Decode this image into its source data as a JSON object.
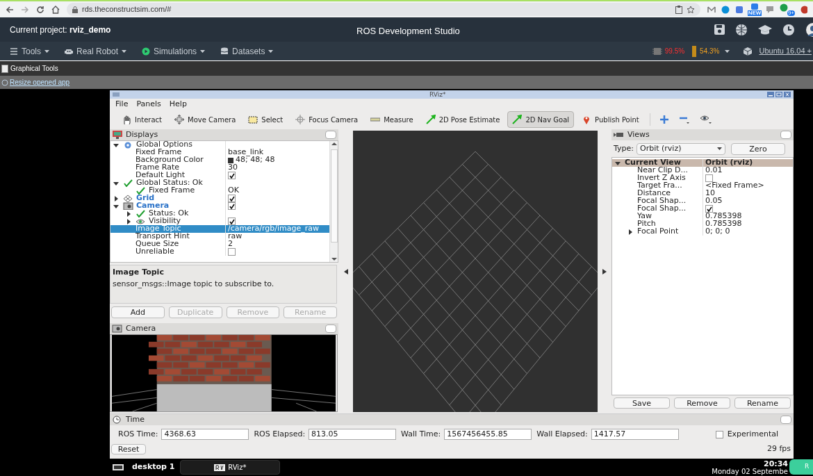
{
  "browser": {
    "url": "rds.theconstructsim.com/#",
    "extension_badges": [
      "NEW",
      "9+"
    ]
  },
  "rds": {
    "project": "Current project: **rviz_demo**",
    "title": "ROS Development Studio",
    "menu": [
      {
        "label": "Tools"
      },
      {
        "label": "Real Robot"
      },
      {
        "label": "Simulations"
      },
      {
        "label": "Datasets"
      }
    ],
    "cpu": "99.5%",
    "memory": "54.3%",
    "os": "Ubuntu 16.04 +"
  },
  "graphical_tools": "Graphical Tools",
  "resize_link": "Resize opened app",
  "rviz": {
    "title": "RViz*",
    "menu": [
      "File",
      "Panels",
      "Help"
    ],
    "toolbar": [
      {
        "label": "Interact",
        "selected": false
      },
      {
        "label": "Move Camera",
        "selected": false
      },
      {
        "label": "Select",
        "selected": false
      },
      {
        "label": "Focus Camera",
        "selected": false
      },
      {
        "label": "Measure",
        "selected": false
      },
      {
        "label": "2D Pose Estimate",
        "selected": false
      },
      {
        "label": "2D Nav Goal",
        "selected": true
      },
      {
        "label": "Publish Point",
        "selected": false
      }
    ],
    "displays": {
      "title": "Displays",
      "tree": [
        {
          "kind": "global-options",
          "label": "Global Options",
          "expanded": true,
          "selected": false,
          "children": [
            {
              "kind": "property",
              "label": "Fixed Frame",
              "value": "base_link",
              "selected": false
            },
            {
              "kind": "property",
              "label": "Background Color",
              "value": "48; 48; 48",
              "color": "#303030",
              "selected": false
            },
            {
              "kind": "property",
              "label": "Frame Rate",
              "value": "30",
              "selected": false
            },
            {
              "kind": "property",
              "label": "Default Light",
              "checked": true,
              "selected": false
            }
          ]
        },
        {
          "kind": "status",
          "label": "Global Status: Ok",
          "expanded": true,
          "selected": false,
          "children": [
            {
              "kind": "status",
              "label": "Fixed Frame",
              "value": "OK",
              "selected": false
            }
          ]
        },
        {
          "kind": "grid-display",
          "label": "Grid",
          "expanded": false,
          "checked": true,
          "selected": false
        },
        {
          "kind": "camera-display",
          "label": "Camera",
          "expanded": true,
          "checked": true,
          "selected": false,
          "children": [
            {
              "kind": "status",
              "label": "Status: Ok",
              "expanded": false,
              "selected": false
            },
            {
              "kind": "visibility",
              "label": "Visibility",
              "expanded": false,
              "checked": true,
              "selected": false
            },
            {
              "kind": "property",
              "label": "Image Topic",
              "value": "/camera/rgb/image_raw",
              "selected": true
            },
            {
              "kind": "property",
              "label": "Transport Hint",
              "value": "raw",
              "selected": false
            },
            {
              "kind": "property",
              "label": "Queue Size",
              "value": "2",
              "selected": false
            },
            {
              "kind": "property",
              "label": "Unreliable",
              "checked": false,
              "selected": false
            }
          ]
        }
      ],
      "description_title": "Image Topic",
      "description": "sensor_msgs::Image topic to subscribe to.",
      "buttons": [
        {
          "label": "Add",
          "disabled": false
        },
        {
          "label": "Duplicate",
          "disabled": true
        },
        {
          "label": "Remove",
          "disabled": true
        },
        {
          "label": "Rename",
          "disabled": true
        }
      ]
    },
    "camera": {
      "title": "Camera"
    },
    "views": {
      "title": "Views",
      "type_label": "Type:",
      "type_value": "Orbit (rviz)",
      "zero": "Zero",
      "tree": [
        {
          "kind": "header",
          "label": "Current View",
          "value": "Orbit (rviz)",
          "expanded": true,
          "children": [
            {
              "label": "Near Clip D...",
              "value": "0.01"
            },
            {
              "label": "Invert Z Axis",
              "checked": false
            },
            {
              "label": "Target Fra...",
              "value": "<Fixed Frame>"
            },
            {
              "label": "Distance",
              "value": "10"
            },
            {
              "label": "Focal Shap...",
              "value": "0.05"
            },
            {
              "label": "Focal Shap...",
              "checked": true
            },
            {
              "label": "Yaw",
              "value": "0.785398"
            },
            {
              "label": "Pitch",
              "value": "0.785398"
            },
            {
              "label": "Focal Point",
              "value": "0; 0; 0",
              "expanded": false
            }
          ]
        }
      ],
      "buttons": [
        "Save",
        "Remove",
        "Rename"
      ]
    },
    "time": {
      "title": "Time",
      "fields": [
        {
          "label": "ROS Time:",
          "value": "4368.63"
        },
        {
          "label": "ROS Elapsed:",
          "value": "813.05"
        },
        {
          "label": "Wall Time:",
          "value": "1567456455.85"
        },
        {
          "label": "Wall Elapsed:",
          "value": "1417.57"
        }
      ],
      "experimental": {
        "label": "Experimental",
        "checked": false
      },
      "reset": "Reset",
      "fps": "29 fps"
    }
  },
  "taskbar": {
    "desktop": "desktop 1",
    "task": "RViz*",
    "time": "20:34",
    "date": "Monday 02 Septembe",
    "corner_button": "R"
  }
}
